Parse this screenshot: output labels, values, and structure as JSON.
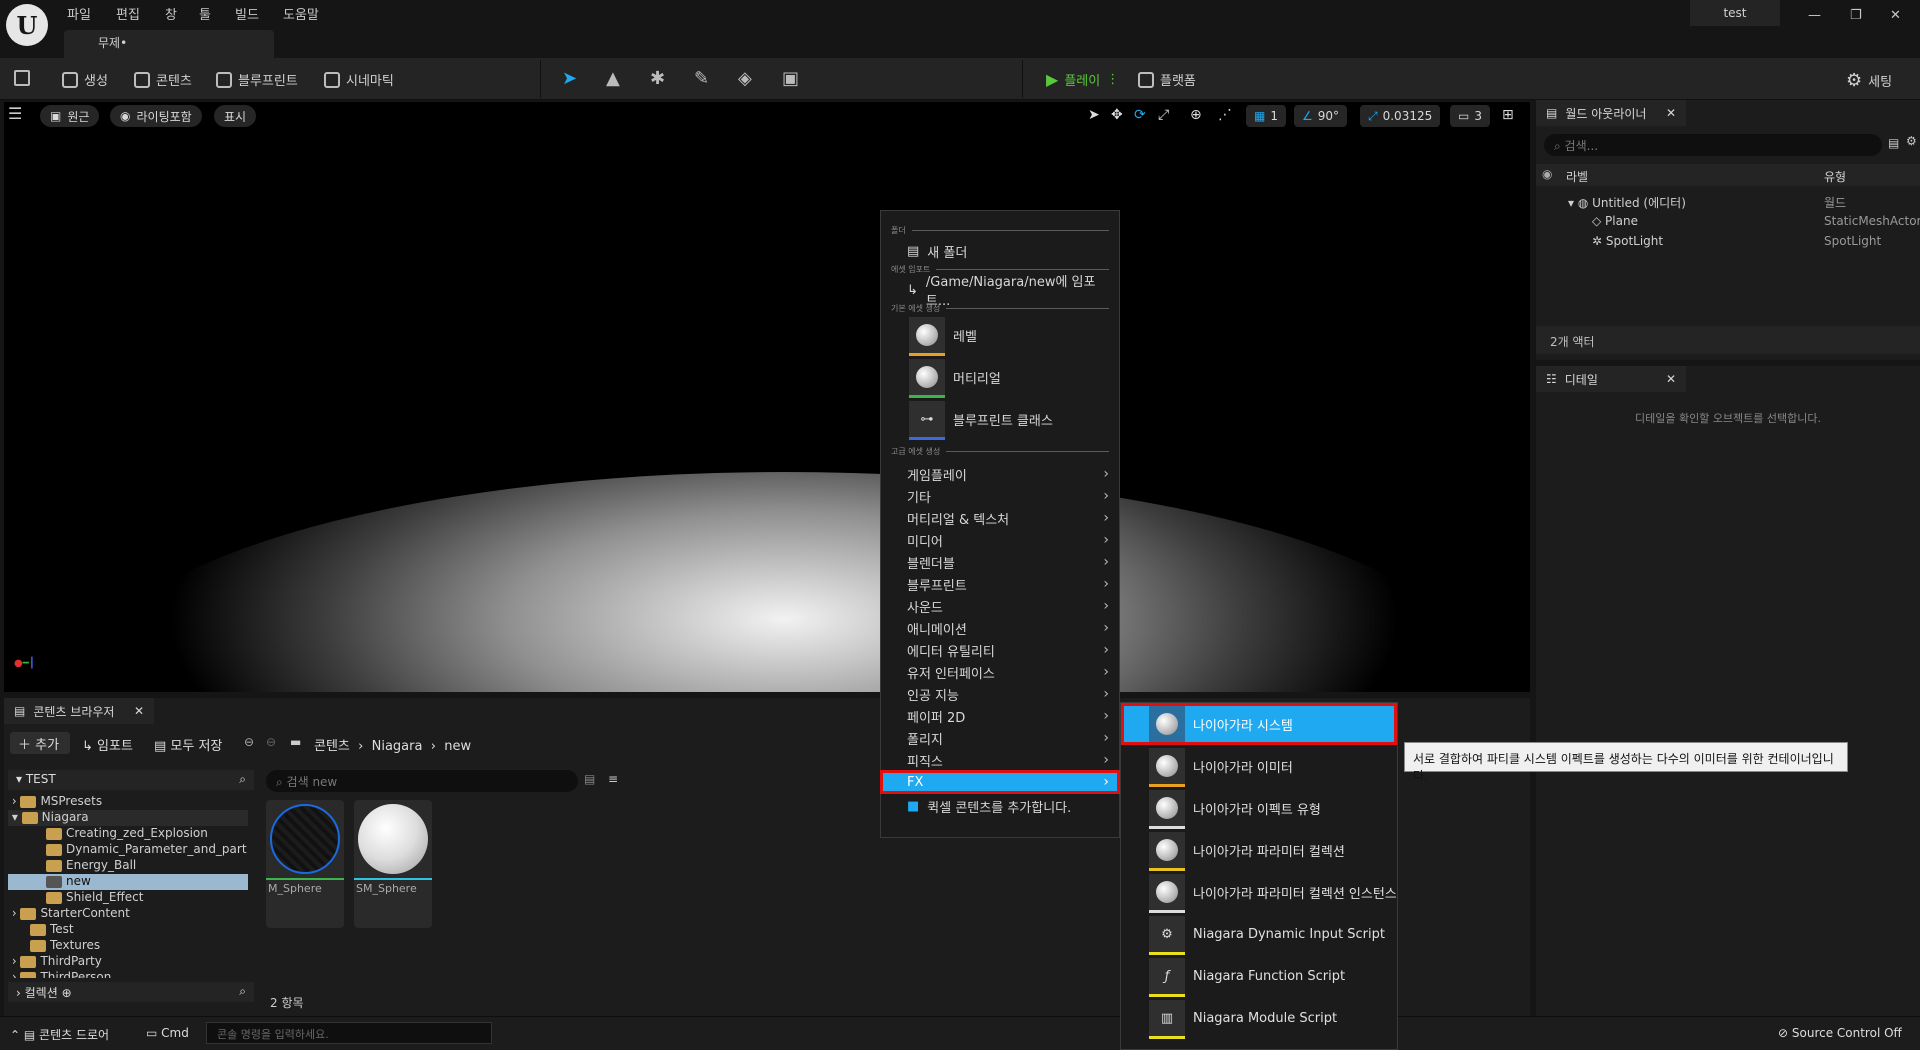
{
  "titlebar": {
    "menus": [
      "파일",
      "편집",
      "창",
      "툴",
      "빌드",
      "도움말"
    ],
    "tab": "무제•",
    "project": "test",
    "win_min": "—",
    "win_max": "❐",
    "win_close": "✕"
  },
  "toolbar": {
    "create": "생성",
    "content": "콘텐츠",
    "blueprint": "블루프린트",
    "cinematic": "시네마틱",
    "play": "플레이",
    "platform": "플랫폼",
    "settings": "세팅"
  },
  "viewport": {
    "perspective": "원근",
    "lighting": "라이팅포함",
    "show": "표시",
    "grid": "1",
    "angle": "90°",
    "scale": "0.03125",
    "camera": "3"
  },
  "outliner": {
    "tab": "월드 아웃라이너",
    "search_placeholder": "검색...",
    "col_label": "라벨",
    "col_type": "유형",
    "rows": [
      {
        "label": "Untitled (에디터)",
        "type": "월드"
      },
      {
        "label": "Plane",
        "type": "StaticMeshActor"
      },
      {
        "label": "SpotLight",
        "type": "SpotLight"
      }
    ],
    "count": "2개 액터"
  },
  "details": {
    "tab": "디테일",
    "empty": "디테일을 확인할 오브젝트를 선택합니다."
  },
  "content_browser": {
    "tab": "콘텐츠 브라우저",
    "add": "추가",
    "import": "임포트",
    "save_all": "모두 저장",
    "path": [
      "콘텐츠",
      "Niagara",
      "new"
    ],
    "search_placeholder": "검색 new",
    "tree_root": "TEST",
    "tree": [
      "MSPresets",
      "Niagara",
      "Creating_zed_Explosion",
      "Dynamic_Parameter_and_part",
      "Energy_Ball",
      "new",
      "Shield_Effect",
      "StarterContent",
      "Test",
      "Textures",
      "ThirdParty",
      "ThirdPerson"
    ],
    "assets": [
      "M_Sphere",
      "SM_Sphere"
    ],
    "count": "2 항목",
    "collections": "컬렉션"
  },
  "status": {
    "drawer": "콘텐츠 드로어",
    "cmd": "Cmd",
    "console_placeholder": "콘솔 명령을 입력하세요.",
    "source_control": "Source Control Off"
  },
  "context_menu": {
    "sec_folder": "폴더",
    "new_folder": "새 폴더",
    "sec_import": "에셋 임포트",
    "import_path": "/Game/Niagara/new에 임포트...",
    "sec_basic": "기본 에셋 생성",
    "level": "레벨",
    "material": "머티리얼",
    "bp_class": "블루프린트 클래스",
    "sec_adv": "고급 에셋 생성",
    "categories": [
      "게임플레이",
      "기타",
      "머티리얼 & 텍스처",
      "미디어",
      "블렌더블",
      "블루프린트",
      "사운드",
      "애니메이션",
      "에디터 유틸리티",
      "유저 인터페이스",
      "인공 지능",
      "페이퍼 2D",
      "폴리지",
      "피직스"
    ],
    "fx": "FX",
    "quixel": "퀵셀 콘텐츠를 추가합니다."
  },
  "fx_submenu": {
    "items": [
      "나이아가라 시스템",
      "나이아가라 이미터",
      "나이아가라 이펙트 유형",
      "나이아가라 파라미터 컬렉션",
      "나이아가라 파라미터 컬렉션 인스턴스",
      "Niagara Dynamic Input Script",
      "Niagara Function Script",
      "Niagara Module Script"
    ],
    "tooltip": "서로 결합하여 파티클 시스템 이펙트를 생성하는 다수의 이미터를 위한 컨테이너입니다."
  },
  "colors": {
    "highlight": "#1fa9f0",
    "selection_outline": "#e01010",
    "play_green": "#5ac83c"
  }
}
